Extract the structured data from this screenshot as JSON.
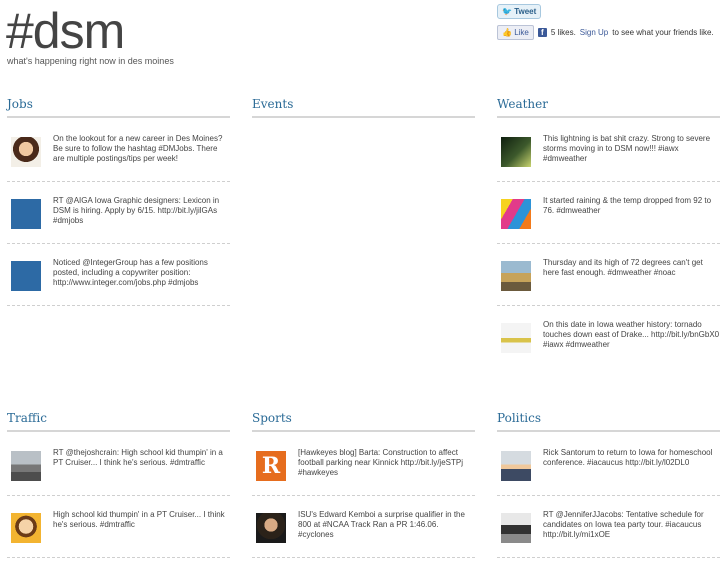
{
  "site": {
    "title": "#dsm",
    "tagline": "what's happening right now in des moines"
  },
  "social": {
    "tweet_label": "Tweet",
    "like_label": "Like",
    "likes_text": "5 likes.",
    "signup_label": "Sign Up",
    "signup_suffix": "to see what your friends like."
  },
  "sections": {
    "jobs": {
      "heading": "Jobs",
      "tweets": [
        {
          "avatar": "woman-portrait",
          "text": "On the lookout for a new career in Des Moines? Be sure to follow the hashtag #DMJobs. There are multiple postings/tips per week!"
        },
        {
          "avatar": "aiga-logo",
          "text": "RT @AIGA Iowa Graphic designers: Lexicon in DSM is hiring. Apply by 6/15. http://bit.ly/jilGAs #dmjobs"
        },
        {
          "avatar": "aiga-logo",
          "text": "Noticed @IntegerGroup has a few positions posted, including a copywriter position: http://www.integer.com/jobs.php #dmjobs"
        }
      ]
    },
    "events": {
      "heading": "Events",
      "tweets": []
    },
    "weather": {
      "heading": "Weather",
      "tweets": [
        {
          "avatar": "storm-photo",
          "text": "This lightning is bat shit crazy. Strong to severe storms moving in to DSM now!!! #iawx #dmweather"
        },
        {
          "avatar": "colorful-photo",
          "text": "It started raining & the temp dropped from 92 to 76. #dmweather"
        },
        {
          "avatar": "fair-photo",
          "text": "Thursday and its high of 72 degrees can't get here fast enough. #dmweather #noac"
        },
        {
          "avatar": "tornado-icon",
          "text": "On this date in Iowa weather history: tornado touches down east of Drake... http://bit.ly/bnGbX0 #iawx #dmweather"
        }
      ]
    },
    "traffic": {
      "heading": "Traffic",
      "tweets": [
        {
          "avatar": "road-photo",
          "text": "RT @thejoshcrain: High school kid thumpin' in a PT Cruiser... I think he's serious. #dmtraffic"
        },
        {
          "avatar": "cartoon-face",
          "text": "High school kid thumpin' in a PT Cruiser... I think he's serious. #dmtraffic"
        }
      ]
    },
    "sports": {
      "heading": "Sports",
      "tweets": [
        {
          "avatar": "r-logo",
          "avatar_text": "R",
          "text": "[Hawkeyes blog] Barta: Construction to affect football parking near Kinnick http://bit.ly/jeSTPj #hawkeyes"
        },
        {
          "avatar": "man-portrait",
          "text": "ISU's Edward Kemboi a surprise qualifier in the 800 at #NCAA Track Ran a PR 1:46.06. #cyclones"
        }
      ]
    },
    "politics": {
      "heading": "Politics",
      "tweets": [
        {
          "avatar": "rick-photo",
          "text": "Rick Santorum to return to Iowa for homeschool conference. #iacaucus http://bit.ly/l02DL0"
        },
        {
          "avatar": "jj-photo",
          "text": "RT @JenniferJJacobs: Tentative schedule for candidates on Iowa tea party tour. #iacaucus http://bit.ly/mi1xOE"
        }
      ]
    }
  }
}
